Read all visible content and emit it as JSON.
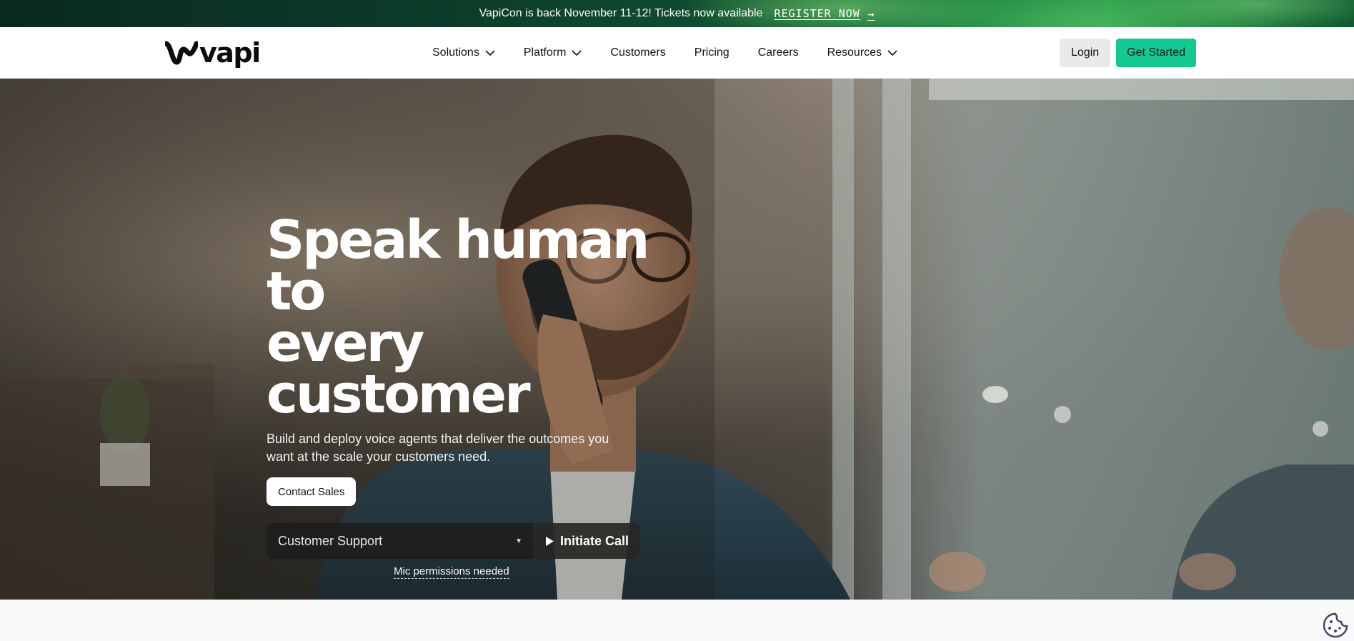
{
  "announcement": {
    "text": "VapiCon is back November 11-12! Tickets now available",
    "link_label": "REGISTER NOW",
    "arrow_icon": "→"
  },
  "nav": {
    "logo_text": "vapi",
    "items": [
      {
        "label": "Solutions",
        "has_dropdown": true
      },
      {
        "label": "Platform",
        "has_dropdown": true
      },
      {
        "label": "Customers",
        "has_dropdown": false
      },
      {
        "label": "Pricing",
        "has_dropdown": false
      },
      {
        "label": "Careers",
        "has_dropdown": false
      },
      {
        "label": "Resources",
        "has_dropdown": true
      }
    ],
    "login_label": "Login",
    "get_started_label": "Get Started"
  },
  "hero": {
    "title_line1": "Speak human to",
    "title_line2": "every customer",
    "subtitle": "Build and deploy voice agents that deliver the outcomes you want at the scale your customers need.",
    "contact_label": "Contact Sales",
    "select_value": "Customer Support",
    "caret_icon": "▼",
    "call_label": "Initiate Call",
    "mic_note": "Mic permissions needed"
  },
  "colors": {
    "accent": "#14c991",
    "announce_bg": "#0c3a28"
  },
  "icons": {
    "chevron": "chevron-down-icon",
    "play": "play-icon",
    "cookie": "cookie-icon",
    "arrow": "arrow-right-icon"
  }
}
